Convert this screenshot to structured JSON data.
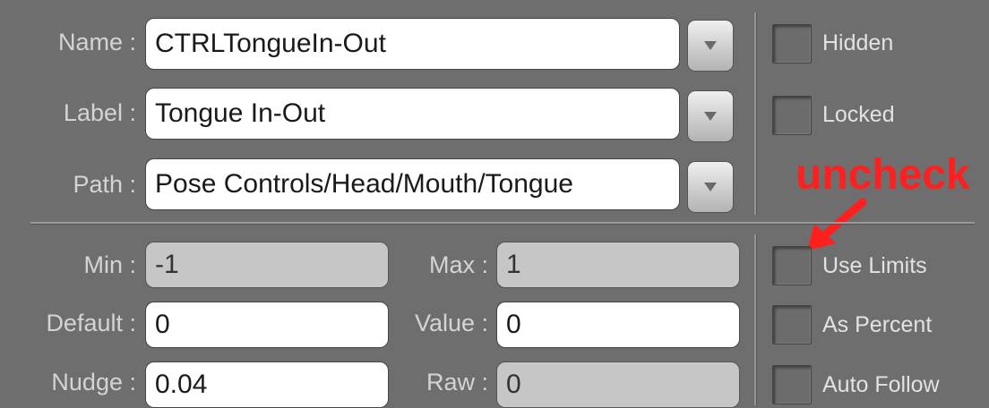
{
  "identity": {
    "name": {
      "label": "Name :",
      "value": "CTRLTongueIn-Out"
    },
    "label": {
      "label": "Label :",
      "value": "Tongue In-Out"
    },
    "path": {
      "label": "Path :",
      "value": "Pose Controls/Head/Mouth/Tongue"
    }
  },
  "flags": {
    "hidden": {
      "label": "Hidden",
      "checked": false
    },
    "locked": {
      "label": "Locked",
      "checked": false
    }
  },
  "values": {
    "min": {
      "label": "Min :",
      "value": "-1"
    },
    "max": {
      "label": "Max :",
      "value": "1"
    },
    "default": {
      "label": "Default :",
      "value": "0"
    },
    "value": {
      "label": "Value :",
      "value": "0"
    },
    "nudge": {
      "label": "Nudge :",
      "value": "0.04"
    },
    "raw": {
      "label": "Raw :",
      "value": "0"
    }
  },
  "options": {
    "use_limits": {
      "label": "Use Limits",
      "checked": false
    },
    "as_percent": {
      "label": "As Percent",
      "checked": false
    },
    "auto_follow": {
      "label": "Auto Follow",
      "checked": false
    }
  },
  "annotation": {
    "text": "uncheck",
    "color": "#ff1f1f"
  },
  "icons": {
    "dropdown": "chevron-down-icon",
    "annotation_arrow": "arrow-icon"
  }
}
